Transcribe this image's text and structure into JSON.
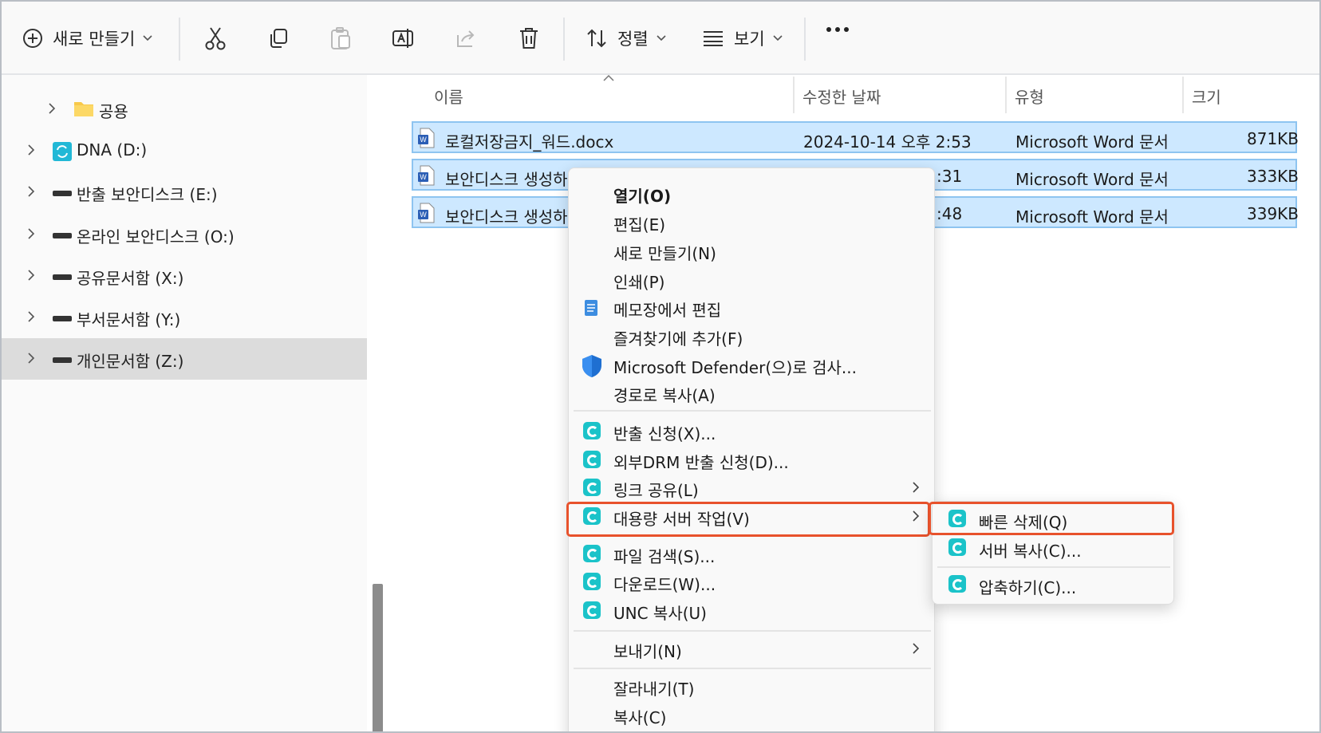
{
  "toolbar": {
    "new_label": "새로 만들기",
    "sort_label": "정렬",
    "view_label": "보기"
  },
  "nav": {
    "items": [
      {
        "label": "공용",
        "icon": "folder-icon"
      },
      {
        "label": "DNA (D:)",
        "icon": "sync-drive-icon"
      },
      {
        "label": "반출 보안디스크 (E:)",
        "icon": "drive-icon"
      },
      {
        "label": "온라인 보안디스크 (O:)",
        "icon": "drive-icon"
      },
      {
        "label": "공유문서함 (X:)",
        "icon": "drive-icon"
      },
      {
        "label": "부서문서함 (Y:)",
        "icon": "drive-icon"
      },
      {
        "label": "개인문서함 (Z:)",
        "icon": "drive-icon"
      }
    ]
  },
  "columns": {
    "name": "이름",
    "modified": "수정한 날짜",
    "type": "유형",
    "size": "크기"
  },
  "files": [
    {
      "name": "로컬저장금지_워드.docx",
      "modified": "2024-10-14 오후 2:53",
      "type": "Microsoft Word 문서",
      "size": "871KB"
    },
    {
      "name": "보안디스크 생성하",
      "modified": ":31",
      "type": "Microsoft Word 문서",
      "size": "333KB"
    },
    {
      "name": "보안디스크 생성하",
      "modified": ":48",
      "type": "Microsoft Word 문서",
      "size": "339KB"
    }
  ],
  "context_menu": {
    "open": "열기(O)",
    "edit": "편집(E)",
    "new": "새로 만들기(N)",
    "print": "인쇄(P)",
    "notepad": "메모장에서 편집",
    "favorites": "즐겨찾기에 추가(F)",
    "defender": "Microsoft Defender(으)로 검사...",
    "copy_path": "경로로 복사(A)",
    "export_request": "반출 신청(X)...",
    "drm_request": "외부DRM 반출 신청(D)...",
    "link_share": "링크 공유(L)",
    "bulk_server": "대용량 서버 작업(V)",
    "file_search": "파일 검색(S)...",
    "download": "다운로드(W)...",
    "unc_copy": "UNC 복사(U)",
    "send_to": "보내기(N)",
    "cut": "잘라내기(T)",
    "copy": "복사(C)"
  },
  "submenu": {
    "quick_delete": "빠른 삭제(Q)",
    "server_copy": "서버 복사(C)...",
    "compress": "압축하기(C)..."
  },
  "colors": {
    "accent_highlight": "#e8522c",
    "selection": "#cde8ff",
    "app_icon": "#1bc3c9"
  }
}
